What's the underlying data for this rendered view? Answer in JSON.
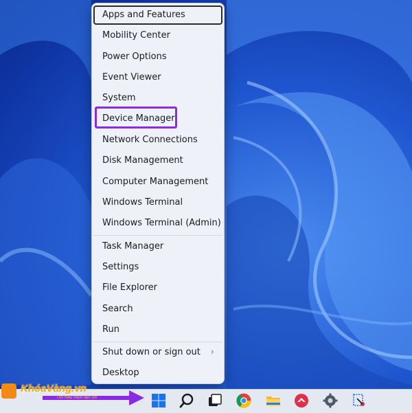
{
  "menu": {
    "items": [
      {
        "label": "Apps and Features"
      },
      {
        "label": "Mobility Center"
      },
      {
        "label": "Power Options"
      },
      {
        "label": "Event Viewer"
      },
      {
        "label": "System"
      },
      {
        "label": "Device Manager"
      },
      {
        "label": "Network Connections"
      },
      {
        "label": "Disk Management"
      },
      {
        "label": "Computer Management"
      },
      {
        "label": "Windows Terminal"
      },
      {
        "label": "Windows Terminal (Admin)"
      },
      {
        "label": "Task Manager"
      },
      {
        "label": "Settings"
      },
      {
        "label": "File Explorer"
      },
      {
        "label": "Search"
      },
      {
        "label": "Run"
      },
      {
        "label": "Shut down or sign out"
      },
      {
        "label": "Desktop"
      }
    ],
    "submenu_arrow": "›",
    "highlighted_item": "Device Manager"
  },
  "watermark": {
    "name": "KhóaVàng.vn",
    "sub": "Tìm hiểu thêm tiện ích"
  },
  "taskbar": {
    "icons": [
      "windows-start-icon",
      "search-icon",
      "task-view-icon",
      "chrome-icon",
      "file-explorer-icon",
      "app-icon",
      "settings-gear-icon",
      "snipping-tool-icon"
    ]
  },
  "colors": {
    "highlight": "#8a2be2",
    "arrow": "#8a2be2",
    "accent": "#1f56cf"
  }
}
